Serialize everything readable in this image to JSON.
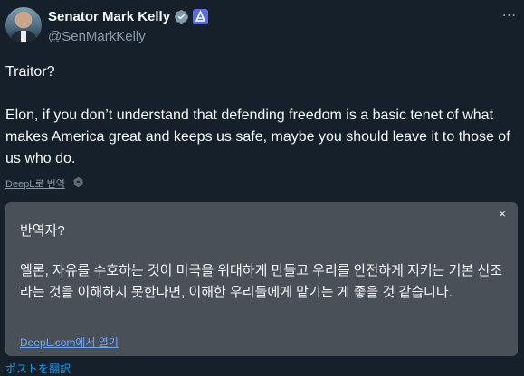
{
  "author": {
    "name": "Senator Mark Kelly",
    "handle": "@SenMarkKelly",
    "verified_color": "#829aab",
    "affiliation_badge_color": "#5b6ee1"
  },
  "more_icon": "⋯",
  "tweet": {
    "line1": "Traitor?",
    "line2": "Elon, if you don’t understand that defending freedom is a basic tenet of what makes America great and keeps us safe, maybe you should leave it to those of us who do."
  },
  "deepl": {
    "translate_link": "DeepL로 번역",
    "panel_title": "반역자?",
    "panel_body": "엘론, 자유를 수호하는 것이 미국을 위대하게 만들고 우리를 안전하게 지키는 기본 신조라는 것을 이해하지 못한다면, 이해한 우리들에게 맡기는 게 좋을 것 같습니다.",
    "open_link": "DeepL.com에서 열기",
    "close_label": "×"
  },
  "translate_post": "ポストを翻訳",
  "colors": {
    "background": "#15202b",
    "panel": "#495057",
    "link": "#1d9bf0"
  }
}
